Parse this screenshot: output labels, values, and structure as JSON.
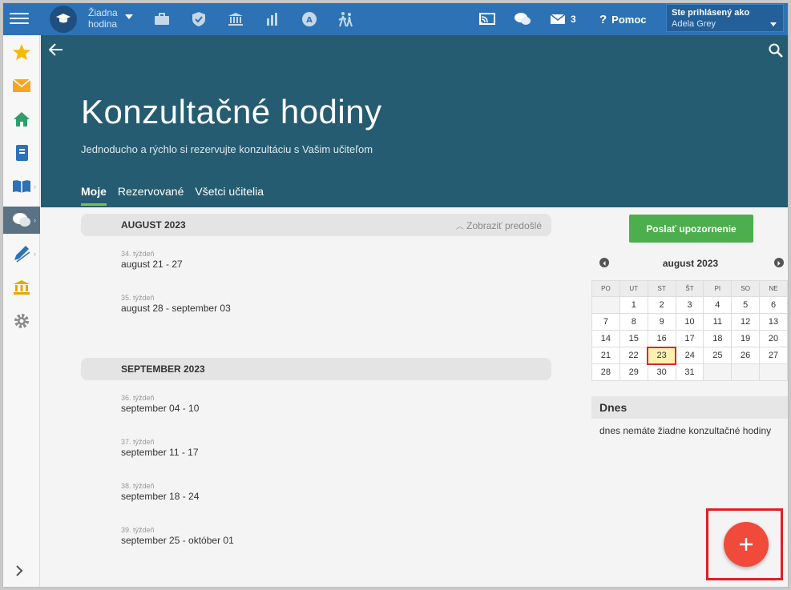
{
  "topbar": {
    "school_line1": "Žiadna",
    "school_line2": "hodina",
    "messages_count": "3",
    "help_label": "Pomoc",
    "signed_in_label": "Ste prihlásený ako",
    "user_name": "Adela Grey"
  },
  "header": {
    "title": "Konzultačné hodiny",
    "subtitle": "Jednoducho a rýchlo si rezervujte konzultáciu s Vašim učiteľom",
    "tabs": [
      "Moje",
      "Rezervované",
      "Všetci učitelia"
    ]
  },
  "schedule": {
    "show_previous": "Zobraziť predošlé",
    "months": [
      {
        "label": "AUGUST 2023",
        "weeks": [
          {
            "week": "34. týždeň",
            "range": "august 21 - 27"
          },
          {
            "week": "35. týždeň",
            "range": "august 28 - september 03"
          }
        ]
      },
      {
        "label": "SEPTEMBER 2023",
        "weeks": [
          {
            "week": "36. týždeň",
            "range": "september 04 - 10"
          },
          {
            "week": "37. týždeň",
            "range": "september 11 - 17"
          },
          {
            "week": "38. týždeň",
            "range": "september 18 - 24"
          },
          {
            "week": "39. týždeň",
            "range": "september 25 - október 01"
          }
        ]
      }
    ]
  },
  "sidebar": {
    "icons": [
      "star-icon",
      "mail-icon",
      "home-icon",
      "notebook-icon",
      "book-icon",
      "chat-icon",
      "pencil-icon",
      "bank-icon",
      "gear-icon"
    ]
  },
  "right": {
    "notify_button": "Poslať upozornenie",
    "calendar_title": "august 2023",
    "weekdays": [
      "PO",
      "UT",
      "ST",
      "ŠT",
      "PI",
      "SO",
      "NE"
    ],
    "weeks": [
      [
        "",
        "1",
        "2",
        "3",
        "4",
        "5",
        "6"
      ],
      [
        "7",
        "8",
        "9",
        "10",
        "11",
        "12",
        "13"
      ],
      [
        "14",
        "15",
        "16",
        "17",
        "18",
        "19",
        "20"
      ],
      [
        "21",
        "22",
        "23",
        "24",
        "25",
        "26",
        "27"
      ],
      [
        "28",
        "29",
        "30",
        "31",
        "",
        "",
        ""
      ]
    ],
    "today": "23",
    "today_heading": "Dnes",
    "today_text": "dnes nemáte žiadne konzultačné hodiny"
  },
  "colors": {
    "topbar": "#2c72b5",
    "header": "#255c72",
    "accent_tab": "#7cc24a",
    "notify_button": "#4cae4c",
    "fab": "#f04a3a"
  }
}
